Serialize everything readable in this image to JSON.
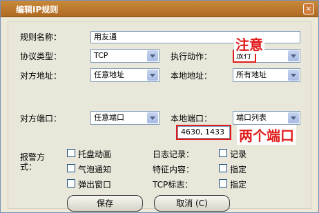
{
  "window": {
    "title": "编辑IP规则",
    "close_icon": "close-icon"
  },
  "form": {
    "rule_name": {
      "label": "规则名称：",
      "value": "用友通"
    },
    "protocol": {
      "label": "协议类型：",
      "value": "TCP"
    },
    "action": {
      "label": "执行动作：",
      "value": "放行"
    },
    "remote_addr": {
      "label": "对方地址：",
      "value": "任意地址"
    },
    "local_addr": {
      "label": "本地地址：",
      "value": "所有地址"
    },
    "remote_port": {
      "label": "对方端口：",
      "value": "任意端口"
    },
    "local_port": {
      "label": "本地端口：",
      "value": "端口列表",
      "ports": "4630, 1433"
    },
    "alert": {
      "label_line1": "报警方",
      "label_line2": "式：",
      "options": [
        "托盘动画",
        "气泡通知",
        "弹出窗口"
      ]
    },
    "log": {
      "label": "日志记录：",
      "option": "记录"
    },
    "feature": {
      "label": "特征内容：",
      "option": "指定"
    },
    "tcp_flag": {
      "label": "TCP标志：",
      "option": "指定"
    }
  },
  "buttons": {
    "save": "保存",
    "cancel": "取消 (C)"
  },
  "annotations": {
    "note": "注意",
    "ports_note": "两个端口"
  },
  "colors": {
    "title_bar": "#c07a2e",
    "annotation": "#e11b1b"
  }
}
